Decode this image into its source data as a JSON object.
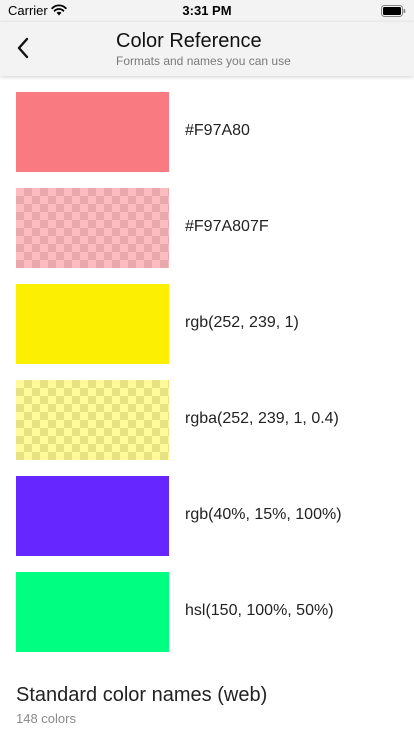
{
  "status_bar": {
    "carrier": "Carrier",
    "time": "3:31 PM"
  },
  "nav": {
    "title": "Color Reference",
    "subtitle": "Formats and names you can use"
  },
  "swatches": [
    {
      "label": "#F97A80",
      "color": "#F97A80",
      "transparent": false
    },
    {
      "label": "#F97A807F",
      "color": "rgba(249,122,128,0.5)",
      "transparent": true
    },
    {
      "label": "rgb(252, 239, 1)",
      "color": "rgb(252,239,1)",
      "transparent": false
    },
    {
      "label": "rgba(252, 239, 1, 0.4)",
      "color": "rgba(252,239,1,0.4)",
      "transparent": true
    },
    {
      "label": "rgb(40%, 15%, 100%)",
      "color": "rgb(102,38,255)",
      "transparent": false
    },
    {
      "label": "hsl(150, 100%, 50%)",
      "color": "hsl(150,100%,50%)",
      "transparent": false
    }
  ],
  "standard_section": {
    "title": "Standard color names (web)",
    "count": "148 colors"
  }
}
